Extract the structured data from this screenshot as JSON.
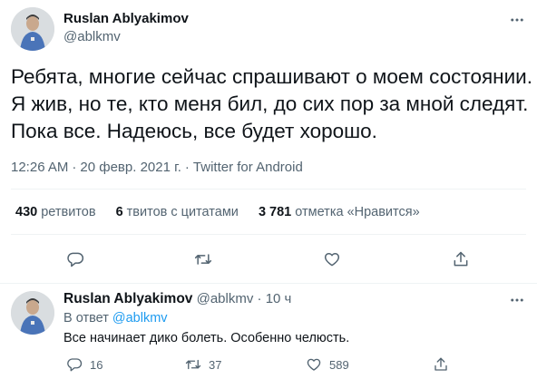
{
  "main_tweet": {
    "author": {
      "name": "Ruslan Ablyakimov",
      "handle": "@ablkmv"
    },
    "text_lines": [
      "Ребята, многие сейчас спрашивают о моем состоянии.",
      "Я жив, но те, кто меня бил, до сих пор за мной следят.",
      "Пока все. Надеюсь, все будет хорошо."
    ],
    "time": "12:26 AM",
    "date": "20 февр. 2021 г.",
    "source": "Twitter for Android",
    "stats": {
      "retweets": {
        "count": "430",
        "label": "ретвитов"
      },
      "quotes": {
        "count": "6",
        "label": "твитов с цитатами"
      },
      "likes": {
        "count": "3 781",
        "label": "отметка «Нравится»"
      }
    }
  },
  "reply": {
    "author": {
      "name": "Ruslan Ablyakimov",
      "handle": "@ablkmv"
    },
    "dot": "·",
    "time": "10 ч",
    "in_reply_prefix": "В ответ",
    "in_reply_handle": "@ablkmv",
    "text": "Все начинает дико болеть. Особенно челюсть.",
    "counts": {
      "replies": "16",
      "retweets": "37",
      "likes": "589"
    }
  },
  "icons": {
    "more": "more-horizontal-icon",
    "reply": "reply-icon",
    "retweet": "retweet-icon",
    "like": "heart-icon",
    "share": "share-icon"
  },
  "colors": {
    "text": "#0f1419",
    "secondary": "#536471",
    "link": "#1d9bf0",
    "divider": "#eff3f4"
  }
}
